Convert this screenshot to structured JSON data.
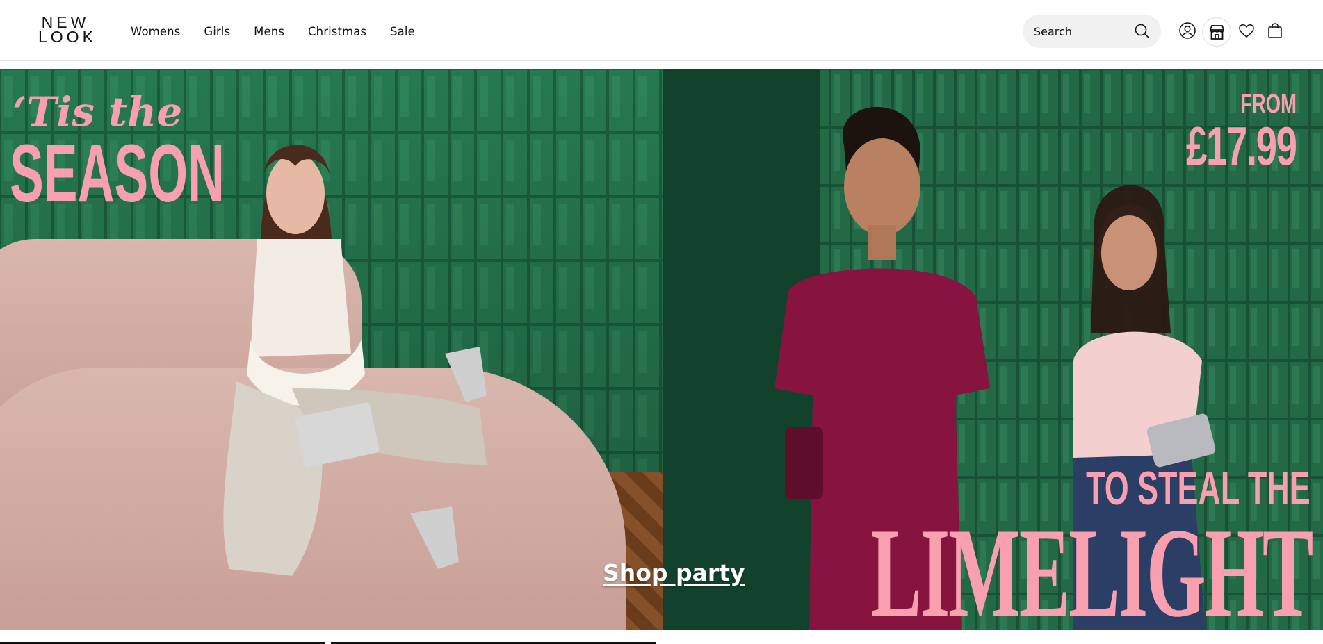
{
  "brand": {
    "logo_line1": "NEW",
    "logo_line2": "LOOK"
  },
  "nav": {
    "items": [
      {
        "label": "Womens"
      },
      {
        "label": "Girls"
      },
      {
        "label": "Mens"
      },
      {
        "label": "Christmas"
      },
      {
        "label": "Sale"
      }
    ]
  },
  "search": {
    "placeholder": "Search",
    "icon": "search-icon"
  },
  "header_icons": [
    "account-icon",
    "store-icon",
    "wishlist-heart-icon",
    "shopping-bag-icon"
  ],
  "hero": {
    "left": {
      "tagline": "‘Tis the",
      "headline": "SEASON"
    },
    "right": {
      "from": "FROM",
      "price": "£17.99",
      "subline": "TO STEAL THE",
      "headline": "LIMELIGHT"
    },
    "cta": "Shop party"
  },
  "colors": {
    "accent_pink": "#f8a0b0",
    "tile_green": "#1d6a45",
    "dark_green": "#17553a",
    "search_bg": "#f1f1f1"
  }
}
